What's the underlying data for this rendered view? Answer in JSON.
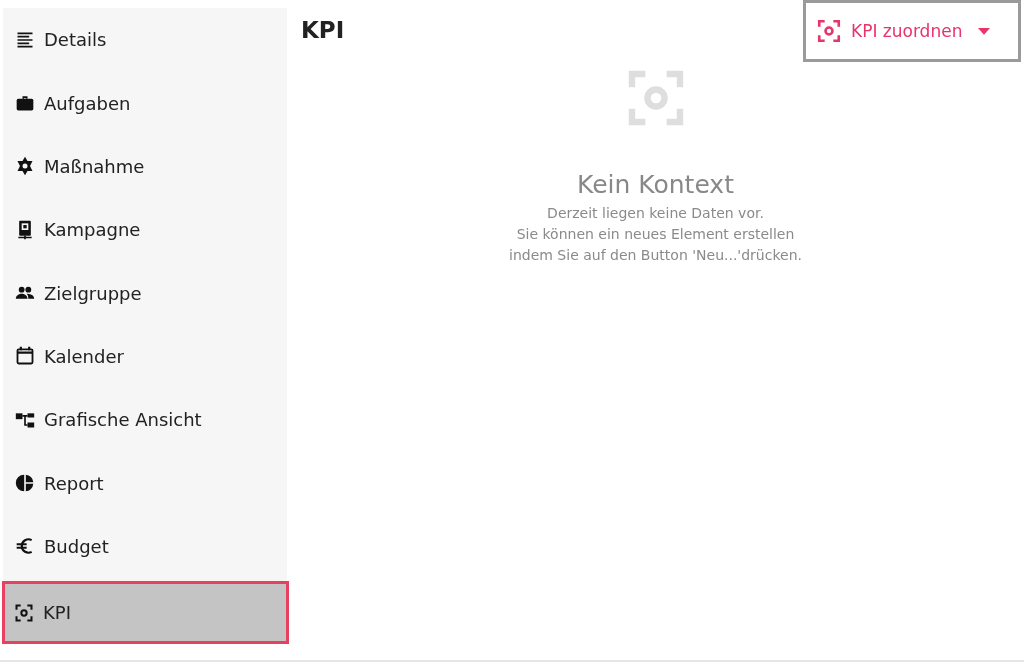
{
  "sidebar": {
    "items": [
      {
        "label": "Details",
        "selected": false
      },
      {
        "label": "Aufgaben",
        "selected": false
      },
      {
        "label": "Maßnahme",
        "selected": false
      },
      {
        "label": "Kampagne",
        "selected": false
      },
      {
        "label": "Zielgruppe",
        "selected": false
      },
      {
        "label": "Kalender",
        "selected": false
      },
      {
        "label": "Grafische Ansicht",
        "selected": false
      },
      {
        "label": "Report",
        "selected": false
      },
      {
        "label": "Budget",
        "selected": false
      },
      {
        "label": "KPI",
        "selected": true
      }
    ]
  },
  "header": {
    "title": "KPI",
    "action_button": {
      "label": "KPI zuordnen"
    }
  },
  "empty_state": {
    "title": "Kein Kontext",
    "lines": [
      "Derzeit liegen keine Daten vor.",
      "Sie können ein neues Element erstellen",
      "indem Sie auf den Button 'Neu...'drücken."
    ]
  }
}
